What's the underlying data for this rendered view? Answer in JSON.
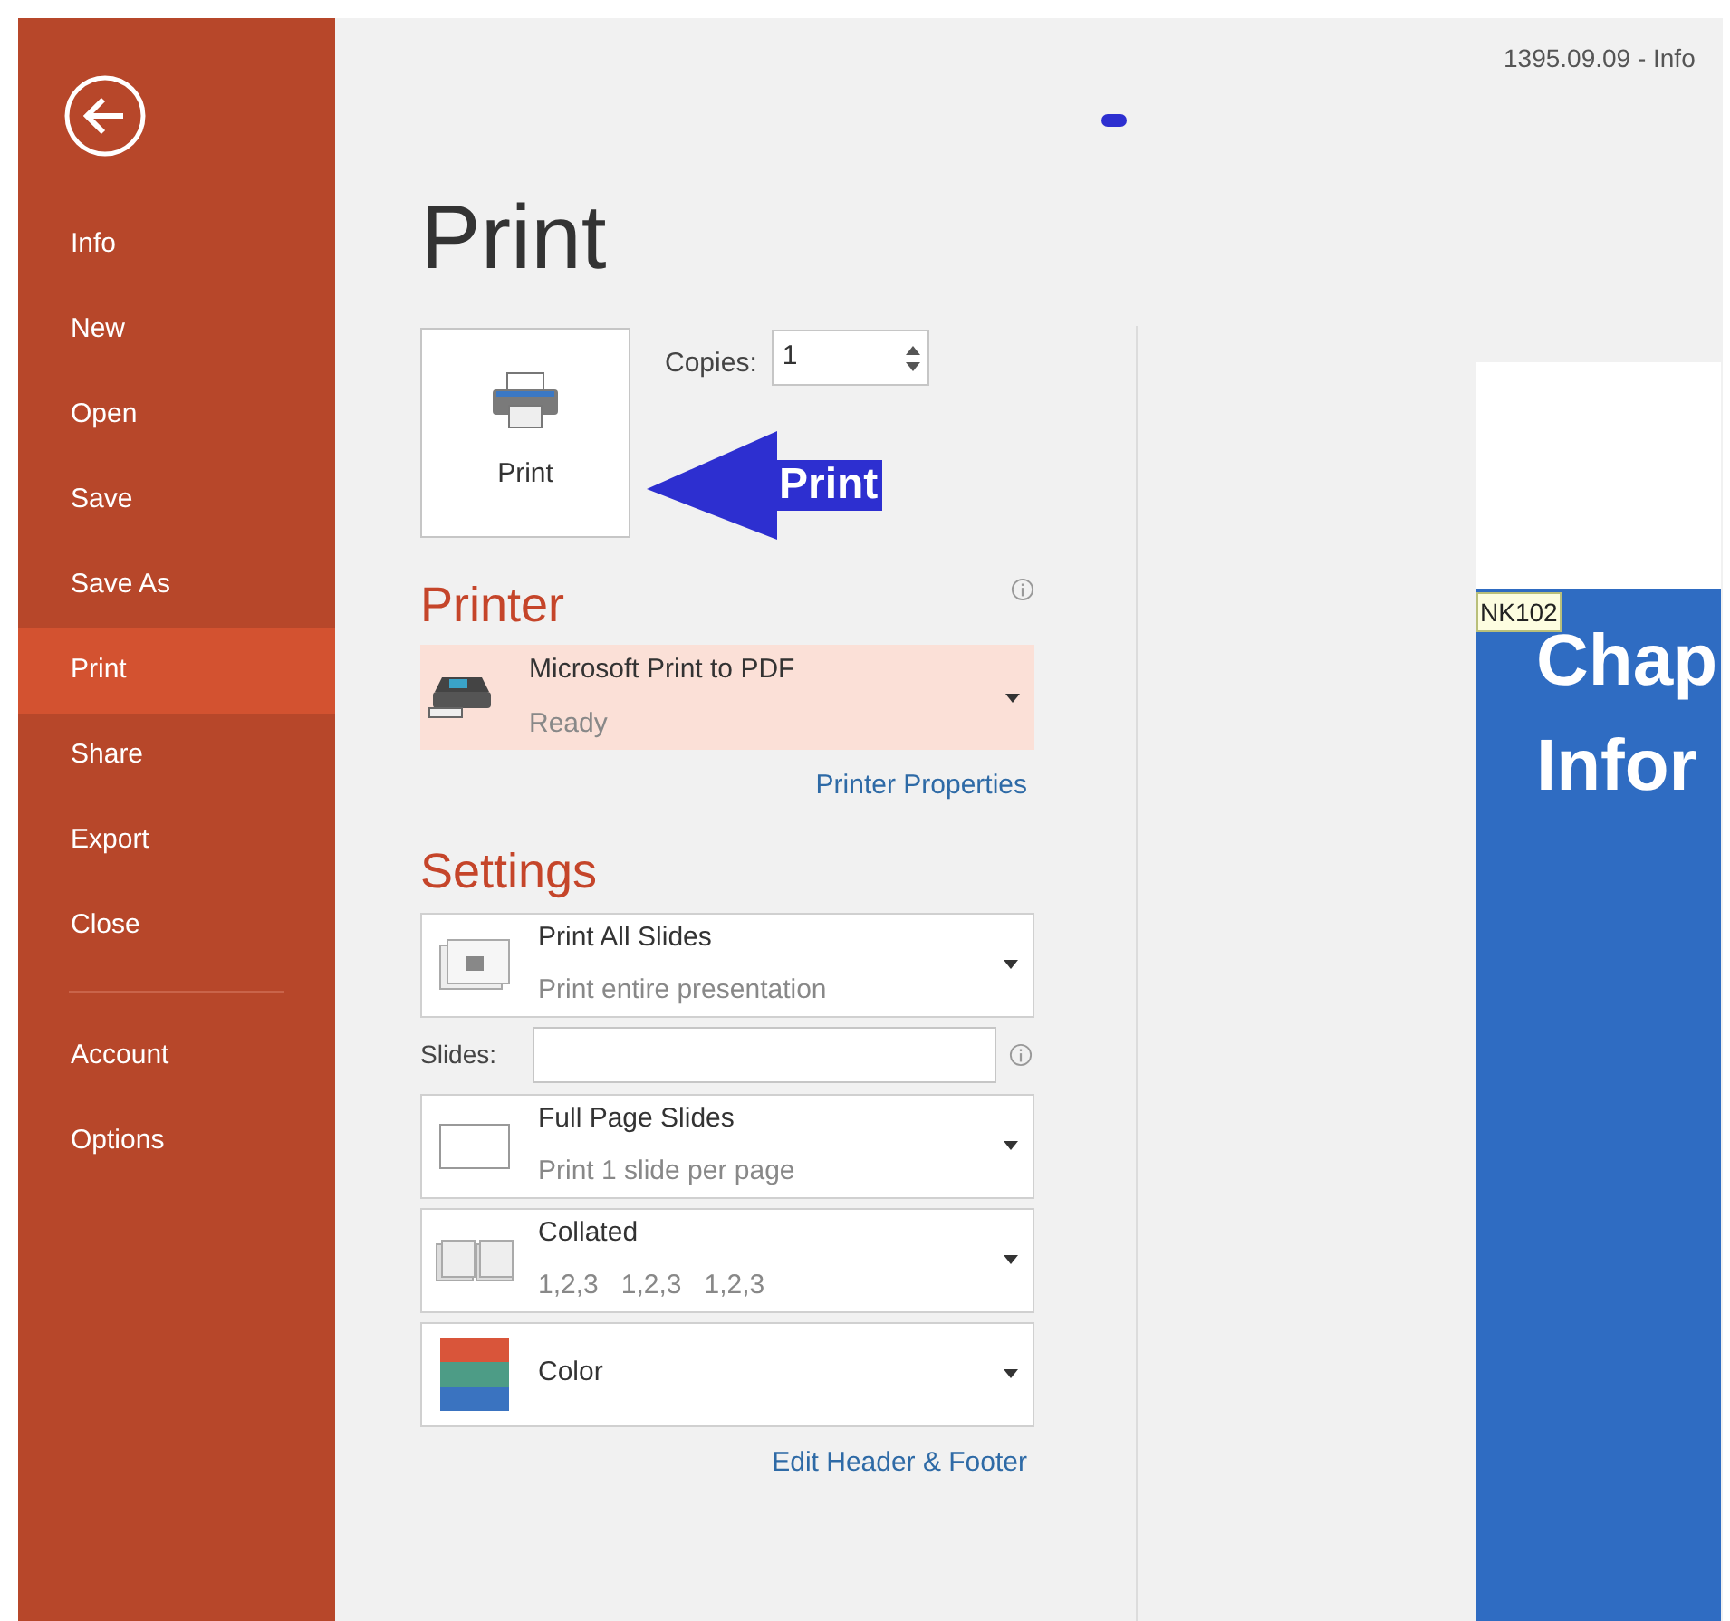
{
  "sidebar": {
    "items": [
      {
        "label": "Info",
        "selected": false
      },
      {
        "label": "New",
        "selected": false
      },
      {
        "label": "Open",
        "selected": false
      },
      {
        "label": "Save",
        "selected": false
      },
      {
        "label": "Save As",
        "selected": false
      },
      {
        "label": "Print",
        "selected": true
      },
      {
        "label": "Share",
        "selected": false
      },
      {
        "label": "Export",
        "selected": false
      },
      {
        "label": "Close",
        "selected": false
      }
    ],
    "bottom_items": [
      {
        "label": "Account",
        "selected": false
      },
      {
        "label": "Options",
        "selected": false
      }
    ]
  },
  "title": "Print",
  "print_button": {
    "label": "Print"
  },
  "copies": {
    "label": "Copies:",
    "value": "1"
  },
  "annotation": {
    "label": "Print"
  },
  "printer": {
    "heading": "Printer",
    "name": "Microsoft Print to PDF",
    "status": "Ready",
    "link": "Printer Properties"
  },
  "settings": {
    "heading": "Settings",
    "dropdowns": [
      {
        "kind": "slides",
        "title": "Print All Slides",
        "subtitle": "Print entire presentation"
      },
      {
        "kind": "slides_field",
        "label": "Slides:"
      },
      {
        "kind": "layout",
        "title": "Full Page Slides",
        "subtitle": "Print 1 slide per page"
      },
      {
        "kind": "collate",
        "title": "Collated",
        "subtitle": "1,2,3   1,2,3   1,2,3"
      },
      {
        "kind": "color",
        "title": "Color"
      }
    ],
    "link": "Edit Header & Footer"
  },
  "document_title": "1395.09.09 - Info",
  "preview": {
    "tag": "NK102",
    "lines": [
      "Chap",
      "Infor"
    ]
  }
}
